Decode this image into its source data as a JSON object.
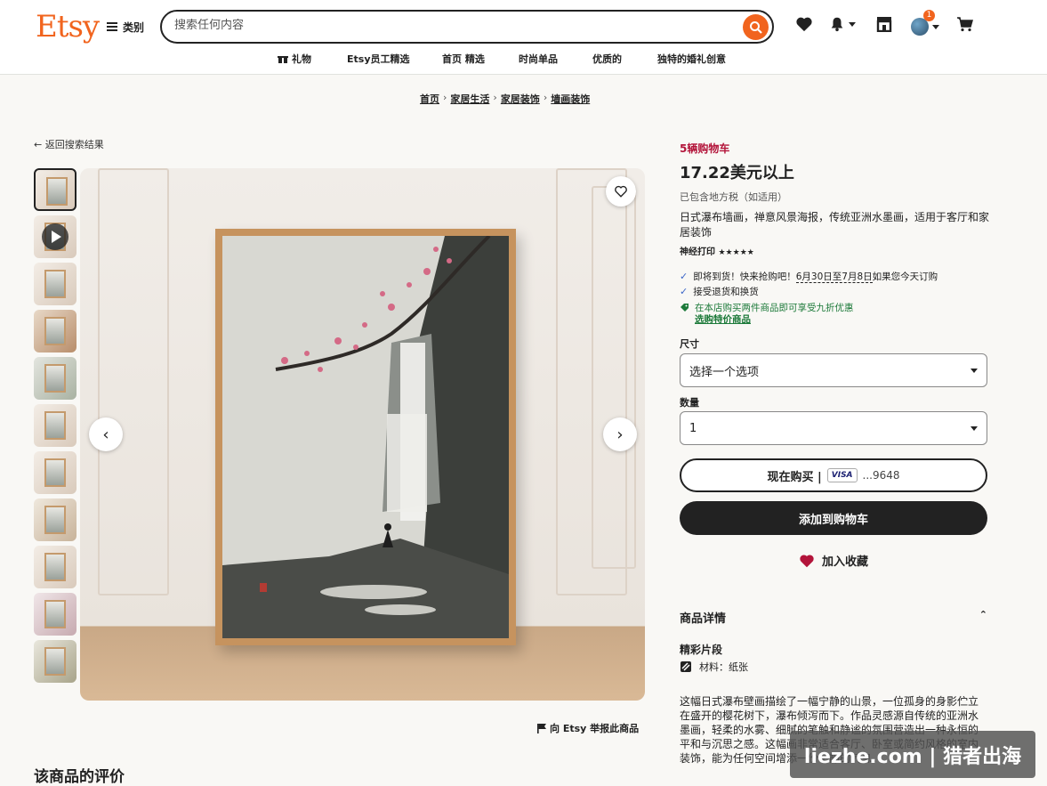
{
  "header": {
    "logo": "Etsy",
    "categories_label": "类别",
    "search_placeholder": "搜索任何内容",
    "cart_badge": "1"
  },
  "nav": {
    "items": [
      {
        "label": "礼物",
        "icon": "gift-icon"
      },
      {
        "label": "Etsy员工精选"
      },
      {
        "label": "首页 精选"
      },
      {
        "label": "时尚单品"
      },
      {
        "label": "优质的"
      },
      {
        "label": "独特的婚礼创意"
      }
    ]
  },
  "breadcrumb": [
    "首页",
    "家居生活",
    "家居装饰",
    "墙画装饰"
  ],
  "back_link": "返回搜索结果",
  "report_link": "向 Etsy 举报此商品",
  "reviews_title": "该商品的评价",
  "product": {
    "stock_note": "5辆购物车",
    "price": "17.22美元以上",
    "tax_note": "已包含地方税（如适用）",
    "title": "日式瀑布墙画，禅意风景海报，传统亚洲水墨画，适用于客厅和家居装饰",
    "shop_name": "神经打印",
    "stars": "★★★★★",
    "delivery_prefix": "即将到货！快来抢购吧！",
    "delivery_dates": "6月30日至7月8日",
    "delivery_suffix": "如果您今天订购",
    "returns": "接受退货和换货",
    "promo": "在本店购买两件商品即可享受九折优惠",
    "promo_link": "选购特价商品"
  },
  "form": {
    "size_label": "尺寸",
    "size_value": "选择一个选项",
    "qty_label": "数量",
    "qty_value": "1",
    "buy_now": "现在购买 |",
    "card_brand": "VISA",
    "card_suffix": "...9648",
    "add_to_cart": "添加到购物车",
    "add_favorite": "加入收藏"
  },
  "details": {
    "header": "商品详情",
    "highlights": "精彩片段",
    "material": "材料：纸张",
    "description": "这幅日式瀑布壁画描绘了一幅宁静的山景，一位孤身的身影伫立在盛开的樱花树下，瀑布倾泻而下。作品灵感源自传统的亚洲水墨画，轻柔的水雾、细腻的笔触和静谧的氛围营造出一种永恒的平和与沉思之感。这幅画非常适合客厅、卧室或简约风格的室内装饰，能为任何空间增添一份宁静的气息。"
  },
  "watermark": "liezhe.com | 猎者出海",
  "colors": {
    "brand": "#f1641e",
    "stock_red": "#b3143a",
    "promo_green": "#1d7a3a",
    "dark_button": "#222222"
  }
}
